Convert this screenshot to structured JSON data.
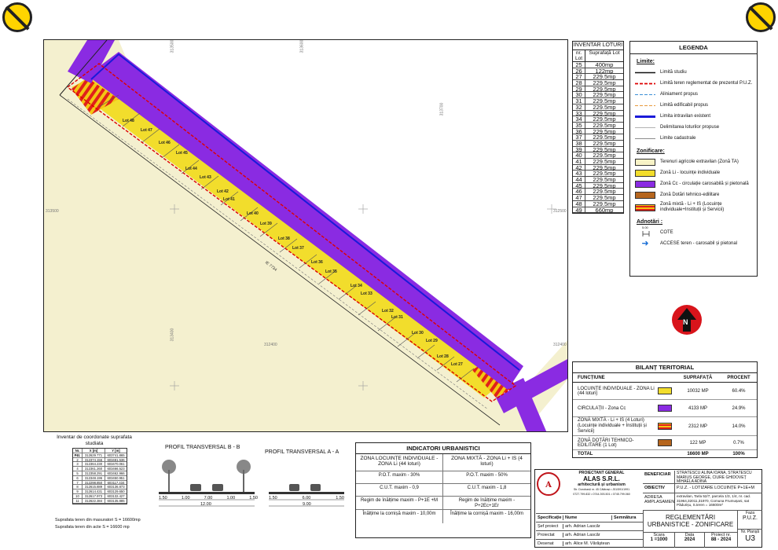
{
  "badges": {
    "left_icon": "prohibition-sign-icon",
    "right_icon": "prohibition-sign-icon"
  },
  "map": {
    "lots": [
      "Lot 48",
      "Lot 47",
      "Lot 46",
      "Lot 45",
      "Lot 44",
      "Lot 43",
      "Lot 42",
      "Lot 41",
      "Lot 40",
      "Lot 39",
      "Lot 38",
      "Lot 37",
      "Lot 36",
      "Lot 35",
      "Lot 34",
      "Lot 33",
      "Lot 32",
      "Lot 31",
      "Lot 30",
      "Lot 29",
      "Lot 28",
      "Lot 27"
    ],
    "coord_labels": [
      "313500",
      "313600",
      "312400",
      "313500",
      "313700",
      "312500",
      "312400",
      "313400"
    ],
    "road_label": "IE 7734",
    "colors": {
      "field": "#f4f0cf",
      "circulatie": "#8a2be2",
      "locuinte": "#f2dd2c",
      "mixta_red": "#e0201b",
      "mixta_yellow": "#f3c612",
      "boundary": "#333"
    }
  },
  "inventar": {
    "title": "INVENTAR LOTURI",
    "col_nr": "nr. Lot",
    "col_sup": "Suprafață Lot",
    "rows": [
      [
        "25",
        "400mp"
      ],
      [
        "26",
        "122mp"
      ],
      [
        "27",
        "229.5mp"
      ],
      [
        "28",
        "229.5mp"
      ],
      [
        "29",
        "229.5mp"
      ],
      [
        "30",
        "229.5mp"
      ],
      [
        "31",
        "229.5mp"
      ],
      [
        "32",
        "229.5mp"
      ],
      [
        "33",
        "229.5mp"
      ],
      [
        "34",
        "229.5mp"
      ],
      [
        "35",
        "229.5mp"
      ],
      [
        "36",
        "229.5mp"
      ],
      [
        "37",
        "229.5mp"
      ],
      [
        "38",
        "229.5mp"
      ],
      [
        "39",
        "229.5mp"
      ],
      [
        "40",
        "229.5mp"
      ],
      [
        "41",
        "229.5mp"
      ],
      [
        "42",
        "229.5mp"
      ],
      [
        "43",
        "229.5mp"
      ],
      [
        "44",
        "229.5mp"
      ],
      [
        "45",
        "229.5mp"
      ],
      [
        "46",
        "229.5mp"
      ],
      [
        "47",
        "229.5mp"
      ],
      [
        "48",
        "229.5mp"
      ],
      [
        "49",
        "660mp"
      ]
    ]
  },
  "legenda": {
    "title": "LEGENDA",
    "limite_title": "Limite:",
    "limite": [
      "Limită studiu",
      "Limită teren reglementat de prezentul P.U.Z.",
      "Aliniament propus",
      "Limită edificabil propus",
      "Limita intravilan existent",
      "Delimitarea loturilor propuse",
      "Limite cadastrale"
    ],
    "zonificare_title": "Zonificare:",
    "zonificare": [
      "Terenuri agricole extravilan (Zonă TA)",
      "Zonă Li - locuințe individuale",
      "Zonă Cc - circulație carosabilă și pietonală",
      "Zonă Dotări tehnico-edilitare",
      "Zonă mixtă - Li + IS (Locuințe individuale+Instituții și Servicii)"
    ],
    "adnotari_title": "Adnotări :",
    "cote_value": "5.00",
    "adnotari": [
      "COTE",
      "ACCESE teren - carosabil și pietonal"
    ],
    "colors": {
      "ta": "#f7f2c6",
      "li": "#f2dd2c",
      "cc": "#8a2be2",
      "dotari": "#b5651d",
      "mixta": "#e0201b"
    }
  },
  "north": {
    "label": "N",
    "icon": "north-arrow-icon"
  },
  "bilant": {
    "title": "BILANȚ TERITORIAL",
    "headers": [
      "FUNCȚIUNE",
      "SUPRAFAȚĂ",
      "PROCENT"
    ],
    "rows": [
      {
        "name": "LOCUINȚE INDIVIDUALE - ZONA Li (44 loturi)",
        "area": "10032 MP",
        "pct": "60.4%",
        "color": "#f2dd2c"
      },
      {
        "name": "CIRCULAȚII - Zona Cc",
        "area": "4133 MP",
        "pct": "24.9%",
        "color": "#8a2be2"
      },
      {
        "name": "ZONĂ MIXTĂ - Li + IS (4 Loturi) (Locuințe individuale + Instituții și Servicii)",
        "area": "2312 MP",
        "pct": "14.0%",
        "color": "#e0201b"
      },
      {
        "name": "ZONĂ DOTĂRI TEHNICO-EDILITARE (1 Lot)",
        "area": "122 MP",
        "pct": "0.7%",
        "color": "#b5651d"
      }
    ],
    "total": {
      "name": "TOTAL",
      "area": "16600 MP",
      "pct": "100%"
    }
  },
  "coordonate": {
    "title": "Inventar de coordonate suprafata studiata",
    "headers": [
      "Nr. Pct.",
      "X [m]",
      "Y [m]"
    ],
    "rows": [
      [
        "1",
        "312629.771",
        "603741.865"
      ],
      [
        "2",
        "312374.156",
        "603481.536"
      ],
      [
        "3",
        "312364.230",
        "603470.061"
      ],
      [
        "4",
        "312361.260",
        "603466.523"
      ],
      [
        "5",
        "312358.291",
        "603462.966"
      ],
      [
        "6",
        "312348.196",
        "603450.951"
      ],
      [
        "7",
        "312298.850",
        "603117.434"
      ],
      [
        "8",
        "312615.889",
        "603136.873"
      ],
      [
        "9",
        "312614.431",
        "603129.650"
      ],
      [
        "10",
        "312617.973",
        "603132.427"
      ],
      [
        "11",
        "312622.384",
        "603135.885"
      ]
    ],
    "surf_mas": "Suprafata teren din masuratori S = 16600mp",
    "surf_acte": "Suprafata teren din acte S = 16600 mp"
  },
  "profil_bb": {
    "title": "PROFIL TRANSVERSAL  B - B",
    "dims": [
      "1.50",
      "1.00",
      "7.00",
      "1.00",
      "1.50"
    ],
    "total": "12.00"
  },
  "profil_aa": {
    "title": "PROFIL TRANSVERSAL  A - A",
    "dims": [
      "1.50",
      "6.00",
      "1.50"
    ],
    "total": "9.00"
  },
  "indicatori": {
    "title": "INDICATORI URBANISTICI",
    "cells": [
      "ZONA LOCUINȚE INDIVIDUALE - ZONA Li (44 loturi)",
      "ZONA MIXTĂ - ZONA Li + IS (4 loturi)",
      "P.O.T. maxim - 30%",
      "P.O.T. maxim - 50%",
      "C.U.T. maxim - 0,9",
      "C.U.T. maxim - 1,8",
      "Regim de înălțime maxim - P+1E +M",
      "Regim de înălțime maxim - P+2Ec+1Er",
      "Înălțime la cornișă maxim - 10,00m",
      "Înălțime la cornișă maxim - 16,00m"
    ]
  },
  "cartus": {
    "proiectant_label": "PROIECTANT GENERAL",
    "firma": "ALAS  S.R.L.",
    "arhitectura": "arhitectură și urbanism",
    "adresa_firma": "Str. Dorobanți nr. 45 Călărași • J51/591/1991",
    "telefon": "0727.799.832 • 0744.393.501 • 0745.799.060",
    "beneficiar_label": "BENEFICIAR",
    "beneficiar": "STRĂTESCU ALINA IOANA, STRĂTESCU MARIUS GEORGE, CIURE GHIDOVEȚ MIHAELA ADINA",
    "obiectiv_label": "OBIECTIV",
    "obiectiv": "P.U.Z. - LOTIZARE LOCUINȚE P+1E+M",
    "adresa_label": "ADRESA AMPLASAMENT",
    "adresa": "extravilan, Tarla 52/7, parcela 1/3, 1/4, nr. cad. 31964,32011,31970, Comuna Frumușani, sat Pădurișu, S.teren = 16600m²",
    "spec_headers": [
      "Specificație",
      "Nume",
      "Semnătura"
    ],
    "persons": [
      [
        "Șef proiect",
        "arh. Adrian Lascăr"
      ],
      [
        "Proiectat",
        "arh. Adrian Lascăr"
      ],
      [
        "Desenat",
        "arh. Alice M. Vărăștean"
      ]
    ],
    "titlu": "REGLEMENTĂRI URBANISTICE - ZONIFICARE",
    "faza_label": "Faza",
    "faza": "P.U.Z.",
    "plansa_label": "Nr. Planșă",
    "plansa": "U3",
    "scara_label": "Scara",
    "scara": "1 =1000",
    "data_label": "Data",
    "data": "2024",
    "proiect_label": "Proiect nr.",
    "proiect": "88 - 2024"
  }
}
